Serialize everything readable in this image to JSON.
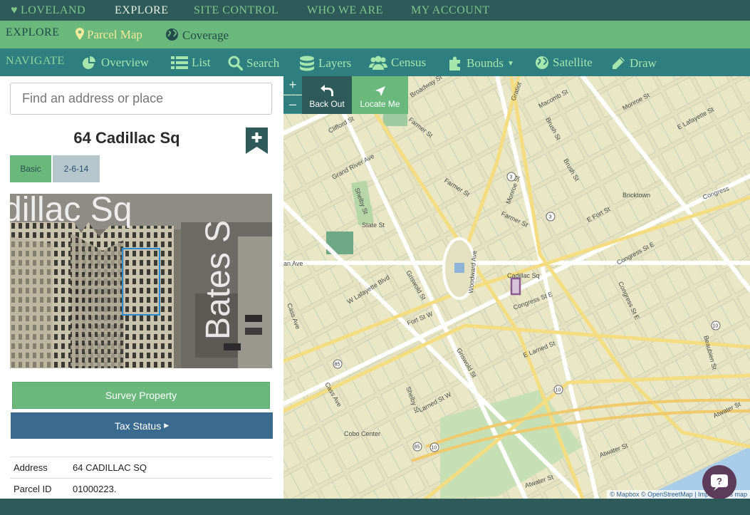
{
  "topnav": {
    "items": [
      "LOVELAND",
      "EXPLORE",
      "SITE CONTROL",
      "WHO WE ARE",
      "MY ACCOUNT"
    ]
  },
  "explore": {
    "label": "EXPLORE",
    "links": [
      "Parcel Map",
      "Coverage"
    ]
  },
  "navigate": {
    "label": "NAVIGATE",
    "items": [
      "Overview",
      "List",
      "Search",
      "Layers",
      "Census",
      "Bounds",
      "Satellite",
      "Draw"
    ]
  },
  "search": {
    "placeholder": "Find an address or place"
  },
  "parcel": {
    "title": "64 Cadillac Sq",
    "tags": [
      "Basic",
      "2-6-14"
    ],
    "photo_text": [
      "dillac Sq",
      "Bates S"
    ],
    "survey_label": "Survey Property",
    "tax_label": "Tax Status",
    "details": [
      {
        "key": "Address",
        "value": "64 CADILLAC SQ"
      },
      {
        "key": "Parcel ID",
        "value": "01000223."
      }
    ]
  },
  "map": {
    "zoom_in": "+",
    "zoom_out": "–",
    "back_label": "Back Out",
    "locate_label": "Locate Me",
    "attribution": "© Mapbox © OpenStreetMap | Improve this map",
    "street_labels": [
      "Broadway St",
      "Gratiot",
      "Macomb St",
      "Monroe St",
      "E Lafayette St",
      "Clifford St",
      "Farmer St",
      "Brush St",
      "Grand River Ave",
      "Shelby St",
      "Farmer St",
      "Monroe St",
      "Brush St",
      "Bricktown",
      "Congress",
      "State St",
      "Farmer St",
      "E Fort St",
      "Woodward Ave",
      "Congress St E",
      "Cadillac Sq",
      "Congress St E",
      "Griswold St",
      "W Lafayette Blvd",
      "Congress St E",
      "Fort St W",
      "Beaubien St",
      "E Larned St",
      "Griswold St",
      "Cass Ave",
      "Shelby St",
      "Larned St W",
      "Cobo Center",
      "Atwater St",
      "Atwater St",
      "Atwater St",
      "an Ave",
      "Cass Ave"
    ],
    "route_numbers": [
      "3",
      "3",
      "10",
      "10",
      "85",
      "85",
      "10"
    ]
  },
  "colors": {
    "topbar": "#2f5a5a",
    "explorebar": "#6ab87c",
    "navbar": "#2f7e80",
    "tax_button": "#3a6a8e",
    "parcel_highlight": "#8a5a8c"
  }
}
